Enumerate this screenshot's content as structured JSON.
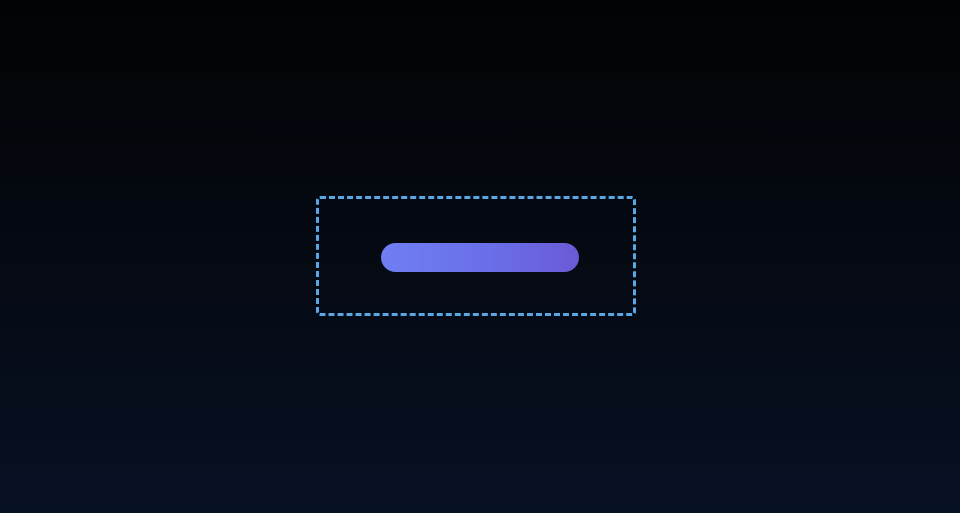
{
  "canvas": {
    "background_top": "#020305",
    "background_bottom": "#071124"
  },
  "selection": {
    "frame_color": "#5aa7e6",
    "style": "dashed"
  },
  "pill_button": {
    "label": "",
    "gradient_start": "#6f7ff2",
    "gradient_end": "#6a5ad6"
  }
}
